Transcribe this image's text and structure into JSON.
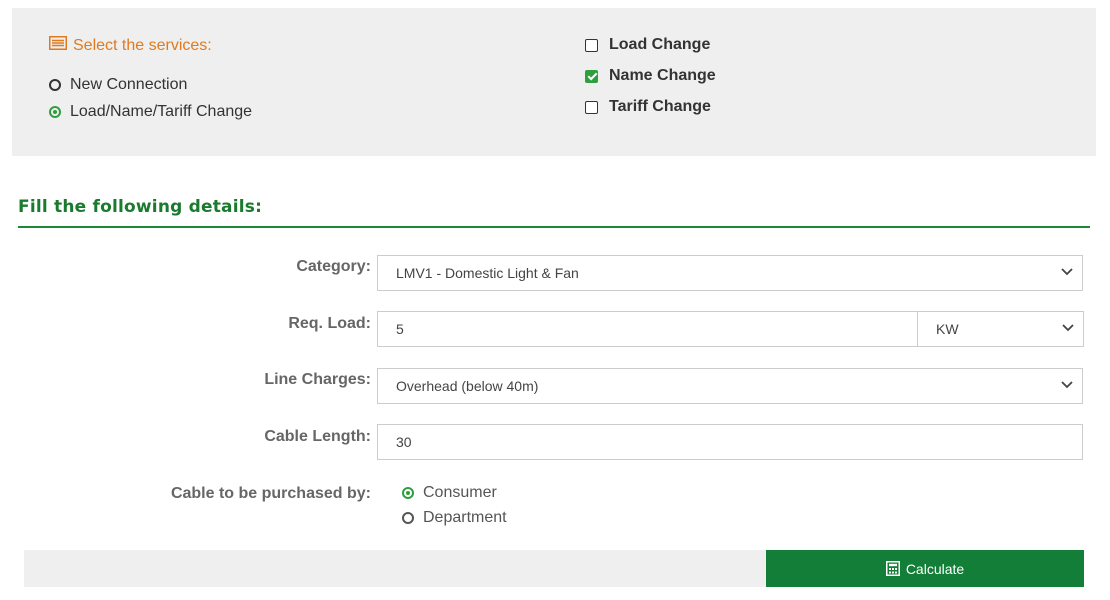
{
  "services": {
    "title": "Select the services:",
    "types": [
      {
        "label": "New Connection",
        "selected": false
      },
      {
        "label": "Load/Name/Tariff Change",
        "selected": true
      }
    ],
    "changes": [
      {
        "label": "Load Change",
        "checked": false
      },
      {
        "label": "Name Change",
        "checked": true
      },
      {
        "label": "Tariff Change",
        "checked": false
      }
    ]
  },
  "details": {
    "heading": "Fill the following details:",
    "category": {
      "label": "Category:",
      "value": "LMV1 - Domestic Light & Fan"
    },
    "req_load": {
      "label": "Req. Load:",
      "value": "5",
      "unit": "KW"
    },
    "line_charges": {
      "label": "Line Charges:",
      "value": "Overhead (below 40m)"
    },
    "cable_length": {
      "label": "Cable Length:",
      "value": "30"
    },
    "cable_purchaser": {
      "label": "Cable to be purchased by:",
      "options": [
        {
          "label": "Consumer",
          "selected": true
        },
        {
          "label": "Department",
          "selected": false
        }
      ]
    }
  },
  "actions": {
    "calculate_label": "Calculate"
  },
  "colors": {
    "accent_green": "#137e37",
    "title_orange": "#e07a1f",
    "panel_gray": "#efefef"
  }
}
